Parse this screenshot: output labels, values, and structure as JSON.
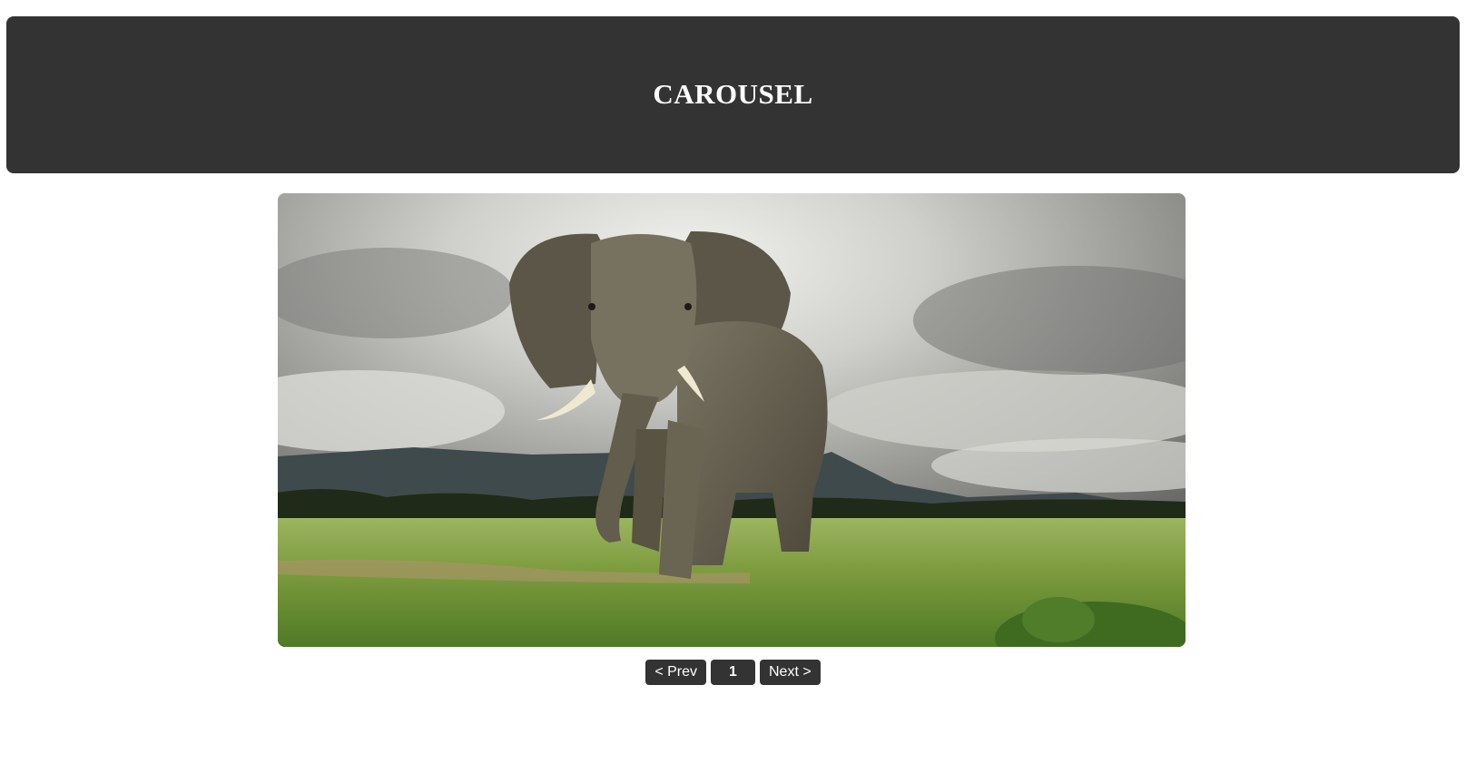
{
  "header": {
    "title": "CAROUSEL"
  },
  "carousel": {
    "image_alt": "elephant-photo",
    "prev_label": "< Prev",
    "current_page": "1",
    "next_label": "Next >"
  },
  "colors": {
    "header_bg": "#333333",
    "button_bg": "#333333",
    "text_light": "#ffffff"
  }
}
